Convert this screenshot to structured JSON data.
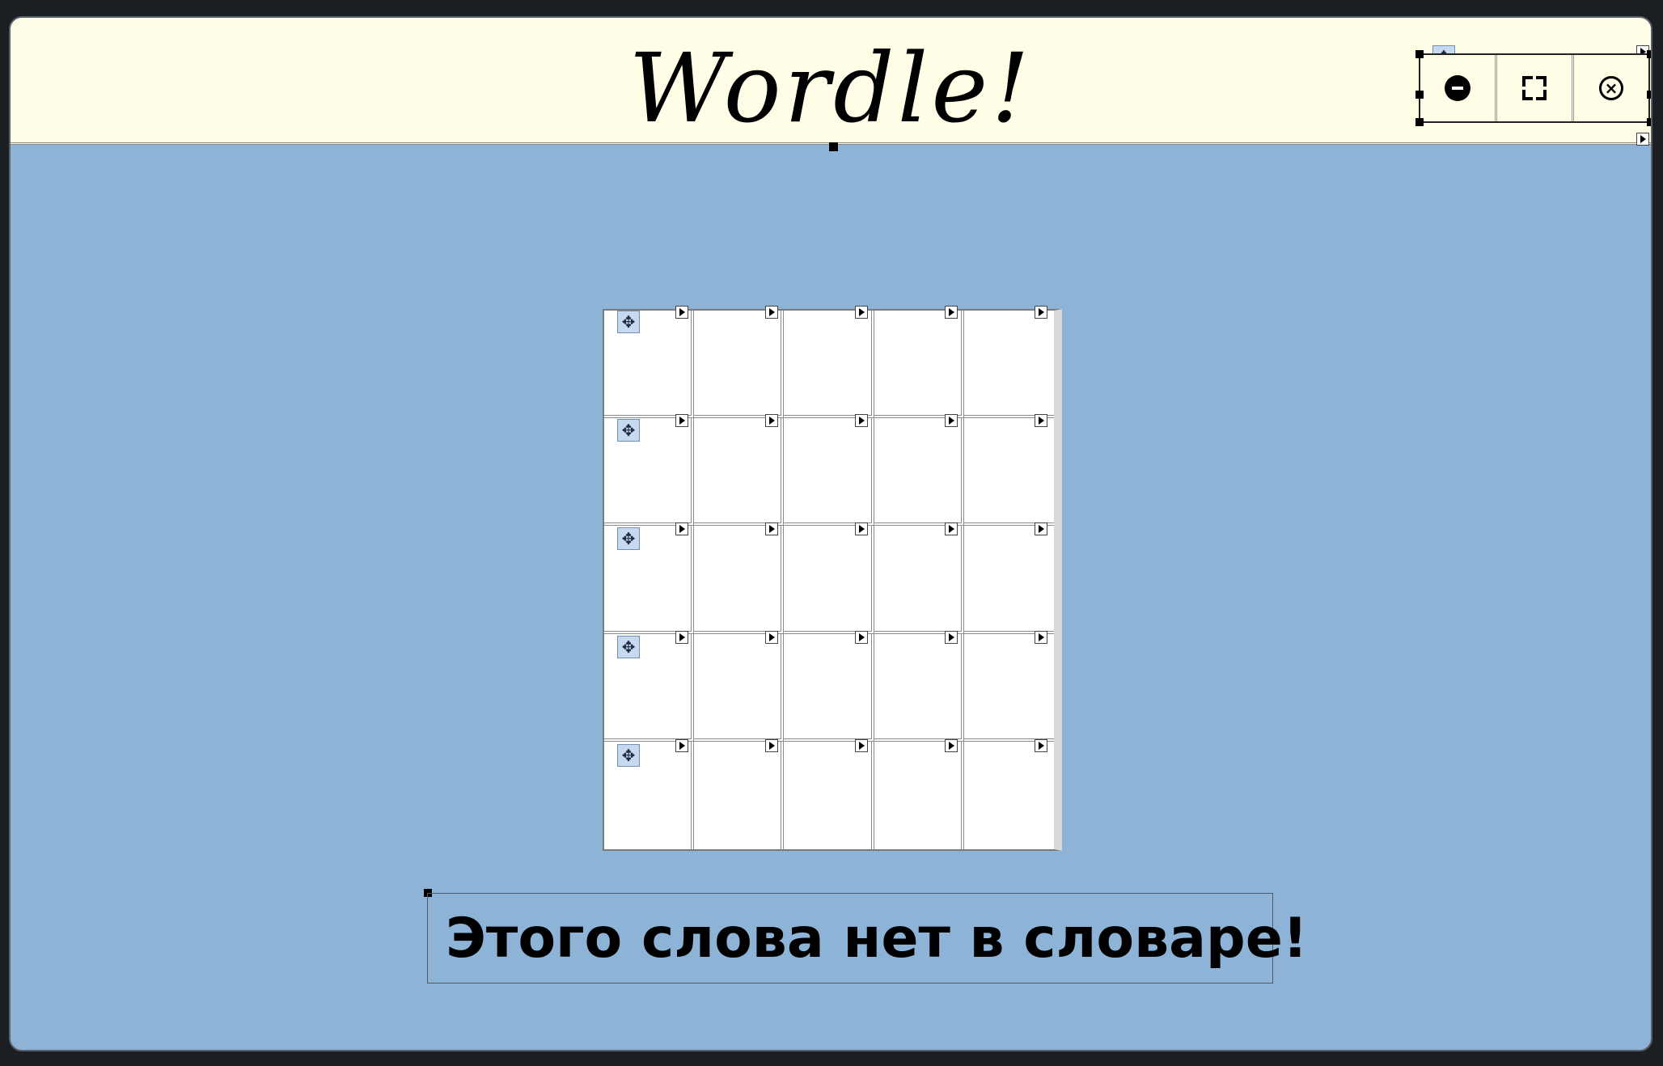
{
  "window": {
    "title": "Wordle!",
    "colors": {
      "titlebar_bg": "#fffde5",
      "content_bg": "#8db3d6",
      "cell_bg": "#ffffff"
    }
  },
  "controls": {
    "minimize_icon": "minimize-icon",
    "maximize_icon": "maximize-icon",
    "close_icon": "close-icon",
    "close_glyph": "×"
  },
  "board": {
    "rows": [
      [
        "",
        "",
        "",
        "",
        ""
      ],
      [
        "",
        "",
        "",
        "",
        ""
      ],
      [
        "",
        "",
        "",
        "",
        ""
      ],
      [
        "",
        "",
        "",
        "",
        ""
      ],
      [
        "",
        "",
        "",
        "",
        ""
      ]
    ]
  },
  "message": {
    "text": "Этого слова нет в словаре!"
  },
  "icons": {
    "move_glyph": "✥"
  }
}
